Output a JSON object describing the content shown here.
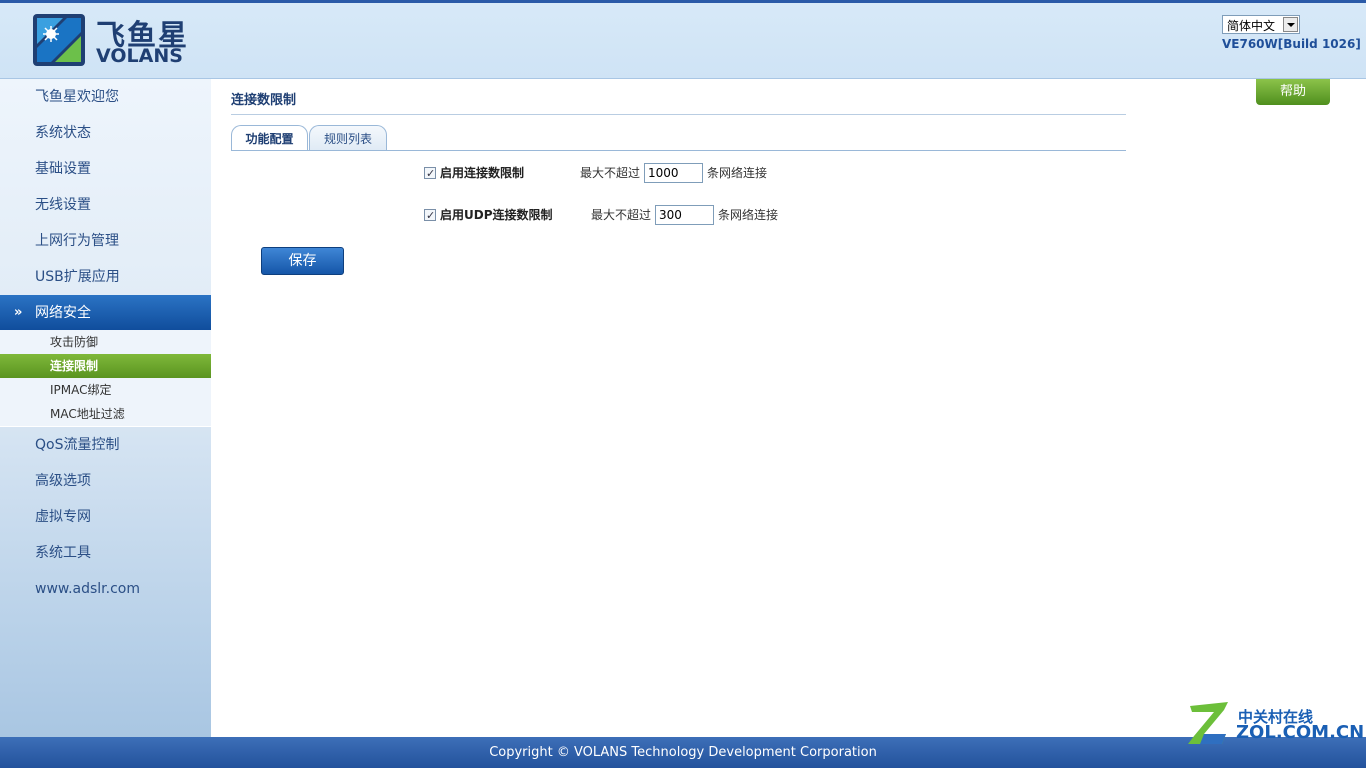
{
  "header": {
    "logo_cn": "飞鱼星",
    "logo_en": "VOLANS",
    "language": "简体中文",
    "version": "VE760W[Build 1026]"
  },
  "sidebar": {
    "items": [
      {
        "label": "飞鱼星欢迎您"
      },
      {
        "label": "系统状态"
      },
      {
        "label": "基础设置"
      },
      {
        "label": "无线设置"
      },
      {
        "label": "上网行为管理"
      },
      {
        "label": "USB扩展应用"
      },
      {
        "label": "网络安全",
        "active": true,
        "icon": "double-chevron-down-icon"
      },
      {
        "label": "QoS流量控制"
      },
      {
        "label": "高级选项"
      },
      {
        "label": "虚拟专网"
      },
      {
        "label": "系统工具"
      },
      {
        "label": "www.adslr.com"
      }
    ],
    "sub_items": [
      {
        "label": "攻击防御"
      },
      {
        "label": "连接限制",
        "active": true
      },
      {
        "label": "IPMAC绑定"
      },
      {
        "label": "MAC地址过滤"
      }
    ]
  },
  "main": {
    "title": "连接数限制",
    "help_label": "帮助",
    "tabs": [
      {
        "label": "功能配置",
        "active": true
      },
      {
        "label": "规则列表",
        "active": false
      }
    ],
    "rows": [
      {
        "checked": true,
        "label": "启用连接数限制",
        "max_prefix": "最大不超过",
        "value": "1000",
        "suffix": "条网络连接"
      },
      {
        "checked": true,
        "label": "启用UDP连接数限制",
        "max_prefix": "最大不超过",
        "value": "300",
        "suffix": "条网络连接"
      }
    ],
    "save_label": "保存"
  },
  "footer": {
    "copyright": "Copyright © VOLANS Technology Development Corporation"
  },
  "watermark": {
    "cn": "中关村在线",
    "en": "ZOL.COM.CN"
  },
  "colors": {
    "brand_blue": "#1f3f73",
    "accent_green": "#5a9420",
    "nav_active_blue": "#0f4c9b"
  }
}
